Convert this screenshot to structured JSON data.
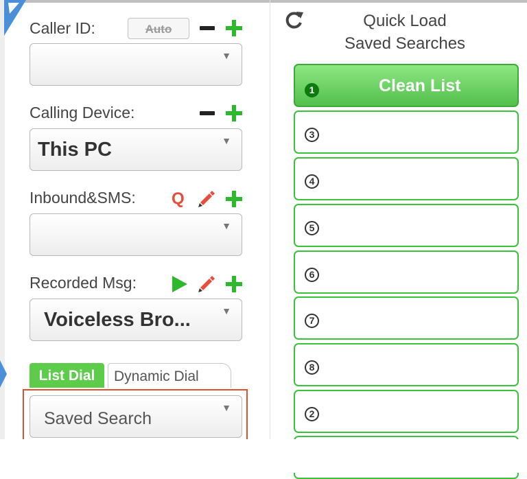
{
  "caller_id": {
    "label": "Caller ID:",
    "auto_label": "Auto",
    "value": ""
  },
  "calling_device": {
    "label": "Calling Device:",
    "value": "This PC"
  },
  "inbound_sms": {
    "label": "Inbound&SMS:",
    "q_label": "Q",
    "value": ""
  },
  "recorded_msg": {
    "label": "Recorded Msg:",
    "value": "Voiceless Bro..."
  },
  "dial_tabs": [
    {
      "label": "List Dial",
      "active": true
    },
    {
      "label": "Dynamic Dial",
      "active": false
    }
  ],
  "saved_search": {
    "value": "Saved Search"
  },
  "quick_load": {
    "title_line1": "Quick Load",
    "title_line2": "Saved Searches",
    "slots": [
      {
        "number": "1",
        "label": "Clean List",
        "active": true
      },
      {
        "number": "3",
        "label": ""
      },
      {
        "number": "4",
        "label": ""
      },
      {
        "number": "5",
        "label": ""
      },
      {
        "number": "6",
        "label": ""
      },
      {
        "number": "7",
        "label": ""
      },
      {
        "number": "8",
        "label": ""
      },
      {
        "number": "2",
        "label": ""
      }
    ]
  },
  "colors": {
    "accent_green": "#2db82d",
    "active_tab": "#5ccc4a",
    "highlight_border": "#d9532c",
    "q_red": "#e74c3c"
  },
  "icons": [
    "refresh-icon",
    "minus-icon",
    "plus-icon",
    "pencil-icon",
    "play-icon",
    "caret-down-icon"
  ]
}
